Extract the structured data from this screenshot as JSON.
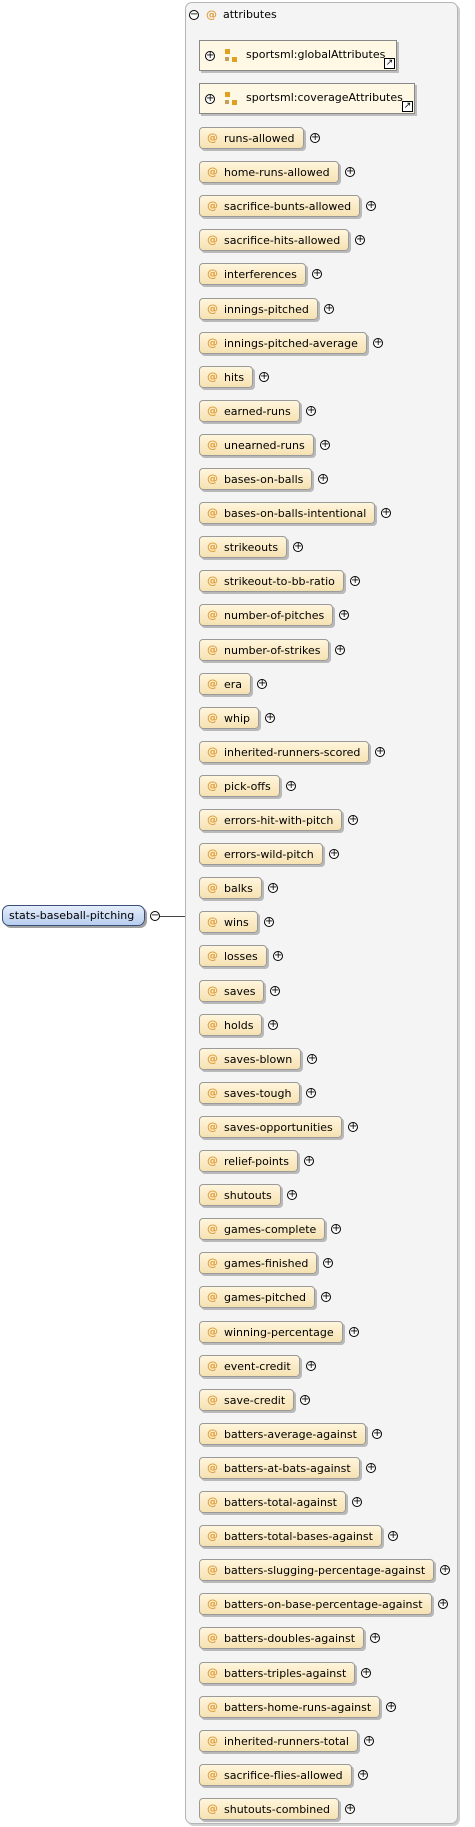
{
  "root": {
    "label": "stats-baseball-pitching"
  },
  "panel": {
    "header": "attributes"
  },
  "groups": [
    {
      "name": "sportsml:globalAttributes"
    },
    {
      "name": "sportsml:coverageAttributes"
    }
  ],
  "attributes": [
    "runs-allowed",
    "home-runs-allowed",
    "sacrifice-bunts-allowed",
    "sacrifice-hits-allowed",
    "interferences",
    "innings-pitched",
    "innings-pitched-average",
    "hits",
    "earned-runs",
    "unearned-runs",
    "bases-on-balls",
    "bases-on-balls-intentional",
    "strikeouts",
    "strikeout-to-bb-ratio",
    "number-of-pitches",
    "number-of-strikes",
    "era",
    "whip",
    "inherited-runners-scored",
    "pick-offs",
    "errors-hit-with-pitch",
    "errors-wild-pitch",
    "balks",
    "wins",
    "losses",
    "saves",
    "holds",
    "saves-blown",
    "saves-tough",
    "saves-opportunities",
    "relief-points",
    "shutouts",
    "games-complete",
    "games-finished",
    "games-pitched",
    "winning-percentage",
    "event-credit",
    "save-credit",
    "batters-average-against",
    "batters-at-bats-against",
    "batters-total-against",
    "batters-total-bases-against",
    "batters-slugging-percentage-against",
    "batters-on-base-percentage-against",
    "batters-doubles-against",
    "batters-triples-against",
    "batters-home-runs-against",
    "inherited-runners-total",
    "sacrifice-flies-allowed",
    "shutouts-combined"
  ]
}
